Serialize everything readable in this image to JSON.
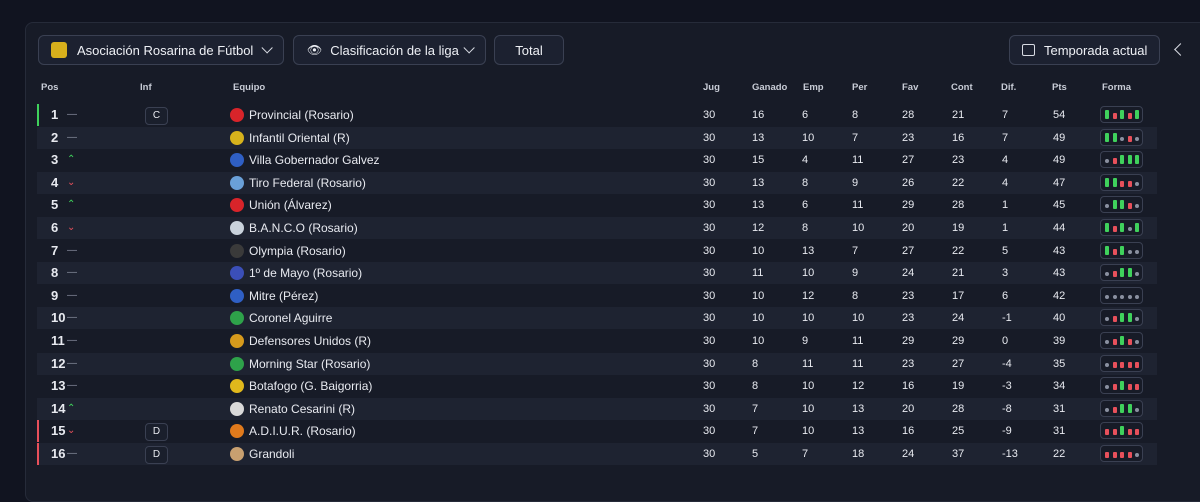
{
  "toolbar": {
    "league": "Asociación Rosarina de Fútbol",
    "view": "Clasificación de la liga",
    "scope": "Total",
    "season": "Temporada actual"
  },
  "headers": {
    "pos": "Pos",
    "inf": "Inf",
    "team": "Equipo",
    "jug": "Jug",
    "ganado": "Ganado",
    "emp": "Emp",
    "per": "Per",
    "fav": "Fav",
    "cont": "Cont",
    "dif": "Dif.",
    "pts": "Pts",
    "forma": "Forma"
  },
  "colors": {
    "green": "#3fd15c",
    "red": "#e8505b",
    "up": "#3fd15c",
    "down": "#e8505b",
    "same": "#8a90a0"
  },
  "rows": [
    {
      "pos": "1",
      "chg": "same",
      "inf": "C",
      "team": "Provincial (Rosario)",
      "crest": "#d8242a",
      "jug": "30",
      "g": "16",
      "e": "6",
      "p": "8",
      "fav": "28",
      "cont": "21",
      "dif": "7",
      "pts": "54",
      "bar": "#3fd15c",
      "form": [
        "W",
        "L",
        "W",
        "L",
        "W"
      ]
    },
    {
      "pos": "2",
      "chg": "same",
      "inf": "",
      "team": "Infantil Oriental (R)",
      "crest": "#d6b21c",
      "jug": "30",
      "g": "13",
      "e": "10",
      "p": "7",
      "fav": "23",
      "cont": "16",
      "dif": "7",
      "pts": "49",
      "bar": "",
      "form": [
        "W",
        "W",
        "D",
        "L",
        "D"
      ]
    },
    {
      "pos": "3",
      "chg": "up",
      "inf": "",
      "team": "Villa Gobernador Galvez",
      "crest": "#2f5fc4",
      "jug": "30",
      "g": "15",
      "e": "4",
      "p": "11",
      "fav": "27",
      "cont": "23",
      "dif": "4",
      "pts": "49",
      "bar": "",
      "form": [
        "D",
        "L",
        "W",
        "W",
        "W"
      ]
    },
    {
      "pos": "4",
      "chg": "down",
      "inf": "",
      "team": "Tiro Federal (Rosario)",
      "crest": "#6aa0d8",
      "jug": "30",
      "g": "13",
      "e": "8",
      "p": "9",
      "fav": "26",
      "cont": "22",
      "dif": "4",
      "pts": "47",
      "bar": "",
      "form": [
        "W",
        "W",
        "L",
        "L",
        "D"
      ]
    },
    {
      "pos": "5",
      "chg": "up",
      "inf": "",
      "team": "Unión (Álvarez)",
      "crest": "#d8242a",
      "jug": "30",
      "g": "13",
      "e": "6",
      "p": "11",
      "fav": "29",
      "cont": "28",
      "dif": "1",
      "pts": "45",
      "bar": "",
      "form": [
        "D",
        "W",
        "W",
        "L",
        "D"
      ]
    },
    {
      "pos": "6",
      "chg": "down",
      "inf": "",
      "team": "B.A.N.C.O (Rosario)",
      "crest": "#c9d2dc",
      "jug": "30",
      "g": "12",
      "e": "8",
      "p": "10",
      "fav": "20",
      "cont": "19",
      "dif": "1",
      "pts": "44",
      "bar": "",
      "form": [
        "W",
        "L",
        "W",
        "D",
        "W"
      ]
    },
    {
      "pos": "7",
      "chg": "same",
      "inf": "",
      "team": "Olympia (Rosario)",
      "crest": "#3a3a3a",
      "jug": "30",
      "g": "10",
      "e": "13",
      "p": "7",
      "fav": "27",
      "cont": "22",
      "dif": "5",
      "pts": "43",
      "bar": "",
      "form": [
        "W",
        "L",
        "W",
        "D",
        "D"
      ]
    },
    {
      "pos": "8",
      "chg": "same",
      "inf": "",
      "team": "1º de Mayo (Rosario)",
      "crest": "#3b4fb8",
      "jug": "30",
      "g": "11",
      "e": "10",
      "p": "9",
      "fav": "24",
      "cont": "21",
      "dif": "3",
      "pts": "43",
      "bar": "",
      "form": [
        "D",
        "L",
        "W",
        "W",
        "D"
      ]
    },
    {
      "pos": "9",
      "chg": "same",
      "inf": "",
      "team": "Mitre (Pérez)",
      "crest": "#2f5fc4",
      "jug": "30",
      "g": "10",
      "e": "12",
      "p": "8",
      "fav": "23",
      "cont": "17",
      "dif": "6",
      "pts": "42",
      "bar": "",
      "form": [
        "D",
        "D",
        "D",
        "D",
        "D"
      ]
    },
    {
      "pos": "10",
      "chg": "same",
      "inf": "",
      "team": "Coronel Aguirre",
      "crest": "#2ea24a",
      "jug": "30",
      "g": "10",
      "e": "10",
      "p": "10",
      "fav": "23",
      "cont": "24",
      "dif": "-1",
      "pts": "40",
      "bar": "",
      "form": [
        "D",
        "L",
        "W",
        "W",
        "D"
      ]
    },
    {
      "pos": "11",
      "chg": "same",
      "inf": "",
      "team": "Defensores Unidos (R)",
      "crest": "#d69a1c",
      "jug": "30",
      "g": "10",
      "e": "9",
      "p": "11",
      "fav": "29",
      "cont": "29",
      "dif": "0",
      "pts": "39",
      "bar": "",
      "form": [
        "D",
        "L",
        "W",
        "L",
        "D"
      ]
    },
    {
      "pos": "12",
      "chg": "same",
      "inf": "",
      "team": "Morning Star (Rosario)",
      "crest": "#2ea24a",
      "jug": "30",
      "g": "8",
      "e": "11",
      "p": "11",
      "fav": "23",
      "cont": "27",
      "dif": "-4",
      "pts": "35",
      "bar": "",
      "form": [
        "D",
        "L",
        "L",
        "L",
        "L"
      ]
    },
    {
      "pos": "13",
      "chg": "same",
      "inf": "",
      "team": "Botafogo (G. Baigorria)",
      "crest": "#e0b81c",
      "jug": "30",
      "g": "8",
      "e": "10",
      "p": "12",
      "fav": "16",
      "cont": "19",
      "dif": "-3",
      "pts": "34",
      "bar": "",
      "form": [
        "D",
        "L",
        "W",
        "L",
        "L"
      ]
    },
    {
      "pos": "14",
      "chg": "up",
      "inf": "",
      "team": "Renato Cesarini (R)",
      "crest": "#d9d9d9",
      "jug": "30",
      "g": "7",
      "e": "10",
      "p": "13",
      "fav": "20",
      "cont": "28",
      "dif": "-8",
      "pts": "31",
      "bar": "",
      "form": [
        "D",
        "L",
        "W",
        "W",
        "D"
      ]
    },
    {
      "pos": "15",
      "chg": "down",
      "inf": "D",
      "team": "A.D.I.U.R. (Rosario)",
      "crest": "#e07a1c",
      "jug": "30",
      "g": "7",
      "e": "10",
      "p": "13",
      "fav": "16",
      "cont": "25",
      "dif": "-9",
      "pts": "31",
      "bar": "#e8505b",
      "form": [
        "L",
        "L",
        "W",
        "L",
        "L"
      ]
    },
    {
      "pos": "16",
      "chg": "same",
      "inf": "D",
      "team": "Grandoli",
      "crest": "#c8a070",
      "jug": "30",
      "g": "5",
      "e": "7",
      "p": "18",
      "fav": "24",
      "cont": "37",
      "dif": "-13",
      "pts": "22",
      "bar": "#e8505b",
      "form": [
        "L",
        "L",
        "L",
        "L",
        "D"
      ]
    }
  ]
}
